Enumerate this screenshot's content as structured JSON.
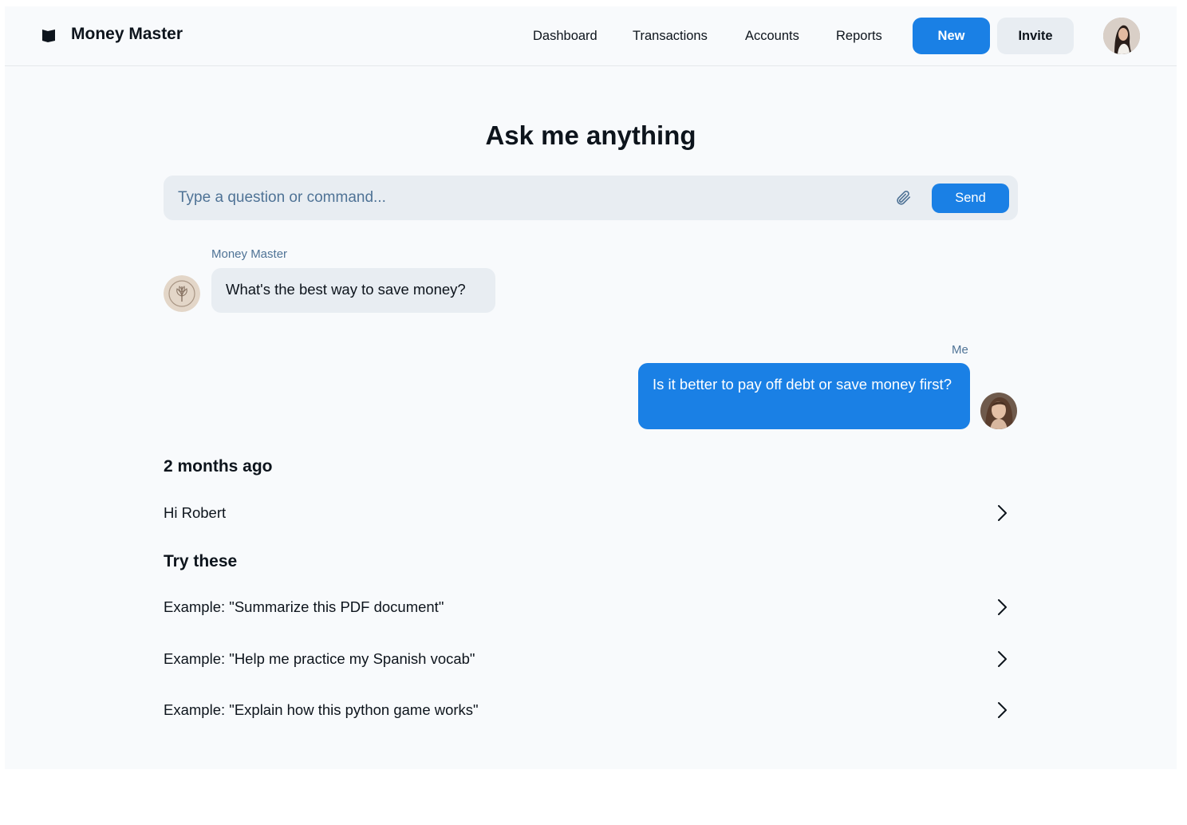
{
  "header": {
    "brand": "Money Master",
    "brand_icon": "flag-icon",
    "nav": [
      "Dashboard",
      "Transactions",
      "Accounts",
      "Reports"
    ],
    "new_label": "New",
    "invite_label": "Invite",
    "avatar": "user-avatar"
  },
  "main": {
    "title": "Ask me anything",
    "search": {
      "placeholder": "Type a question or command...",
      "value": "",
      "attach_icon": "paperclip-icon",
      "send_label": "Send"
    },
    "messages": [
      {
        "sender": "Money Master",
        "text": "What's the best way to save money?",
        "avatar": "bot-avatar"
      },
      {
        "sender": "Me",
        "text": "Is it better to pay off debt or save money first?",
        "avatar": "user-avatar"
      }
    ],
    "history": {
      "heading": "2 months ago",
      "items": [
        "Hi Robert"
      ]
    },
    "suggestions": {
      "heading": "Try these",
      "items": [
        "Example: \"Summarize this PDF document\"",
        "Example: \"Help me practice my Spanish vocab\"",
        "Example: \"Explain how this python game works\""
      ]
    }
  },
  "colors": {
    "accent": "#1a80e5",
    "surface": "#e8edf2",
    "muted_text": "#4f7396",
    "background": "#f8fafc",
    "text": "#0d141c"
  }
}
